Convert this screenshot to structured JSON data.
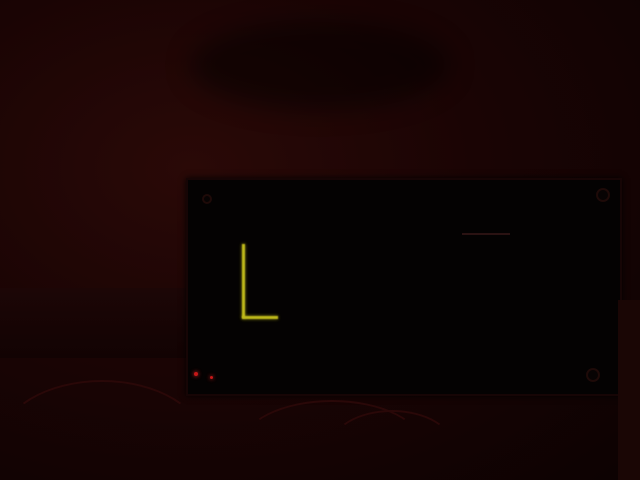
{
  "scene": {
    "background_color": "#1a0404",
    "display_text_color": "#d6d21c",
    "led_color": "#c71818"
  },
  "display": {
    "labels": [
      "",
      "",
      "",
      "",
      "",
      "",
      ""
    ],
    "bottom_row": "",
    "note": ""
  }
}
